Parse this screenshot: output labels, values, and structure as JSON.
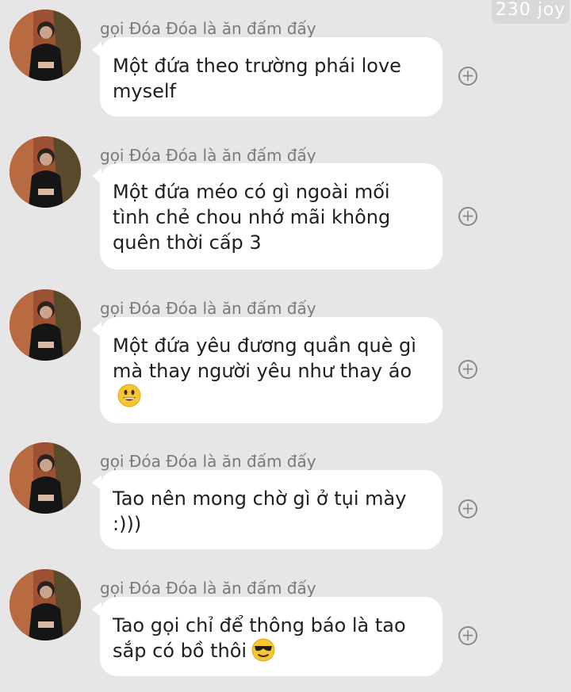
{
  "watermark": "230 joy",
  "messages": [
    {
      "sender": "gọi Đóa Đóa là ăn đấm đấy",
      "text": "Một đứa theo trường phái love myself",
      "emoji": "",
      "add_icon": "plus-circle-icon"
    },
    {
      "sender": "gọi Đóa Đóa là ăn đấm đấy",
      "text": "Một đứa méo có gì ngoài mối tình chẻ chou nhớ mãi không quên thời cấp 3",
      "emoji": "",
      "add_icon": "plus-circle-icon"
    },
    {
      "sender": "gọi Đóa Đóa là ăn đấm đấy",
      "text": "Một đứa yêu đương quần què gì mà thay người yêu như thay áo",
      "emoji": "grinning-face-emoji",
      "add_icon": "plus-circle-icon"
    },
    {
      "sender": "gọi Đóa Đóa là ăn đấm đấy",
      "text": "Tao nên mong chờ gì ở tụi mày :)))",
      "emoji": "",
      "add_icon": "plus-circle-icon"
    },
    {
      "sender": "gọi Đóa Đóa là ăn đấm đấy",
      "text": "Tao gọi chỉ để thông báo là tao sắp có bồ thôi",
      "emoji": "sunglasses-face-emoji",
      "add_icon": "plus-circle-icon"
    }
  ]
}
